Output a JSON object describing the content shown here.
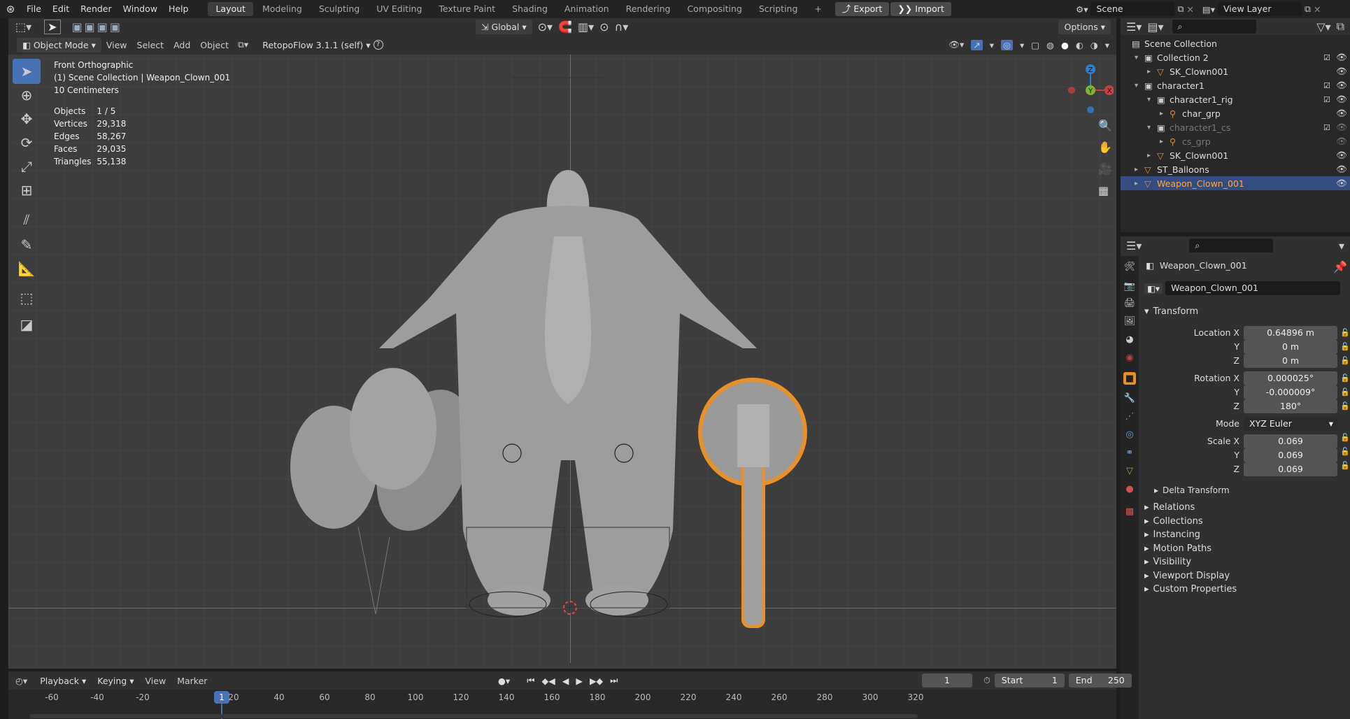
{
  "menu": {
    "items": [
      "File",
      "Edit",
      "Render",
      "Window",
      "Help"
    ]
  },
  "workspaces": [
    "Layout",
    "Modeling",
    "Sculpting",
    "UV Editing",
    "Texture Paint",
    "Shading",
    "Animation",
    "Rendering",
    "Compositing",
    "Scripting"
  ],
  "active_workspace": "Layout",
  "export_label": "Export",
  "import_label": "Import",
  "scene": "Scene",
  "view_layer": "View Layer",
  "header": {
    "mode": "Object Mode",
    "view": "View",
    "select": "Select",
    "add": "Add",
    "object": "Object",
    "orientation": "Global",
    "addon": "RetopoFlow 3.1.1 (self)",
    "options": "Options"
  },
  "viewport": {
    "view_name": "Front Orthographic",
    "collection_path": "(1) Scene Collection | Weapon_Clown_001",
    "scale": "10 Centimeters",
    "stats": [
      {
        "label": "Objects",
        "value": "1 / 5"
      },
      {
        "label": "Vertices",
        "value": "29,318"
      },
      {
        "label": "Edges",
        "value": "58,267"
      },
      {
        "label": "Faces",
        "value": "29,035"
      },
      {
        "label": "Triangles",
        "value": "55,138"
      }
    ]
  },
  "outliner": {
    "rows": [
      {
        "label": "Scene Collection",
        "depth": 0,
        "type": "scene"
      },
      {
        "label": "Collection 2",
        "depth": 1,
        "type": "collection"
      },
      {
        "label": "SK_Clown001",
        "depth": 2,
        "type": "mesh"
      },
      {
        "label": "character1",
        "depth": 1,
        "type": "collection"
      },
      {
        "label": "character1_rig",
        "depth": 2,
        "type": "collection"
      },
      {
        "label": "char_grp",
        "depth": 3,
        "type": "armature"
      },
      {
        "label": "character1_cs",
        "depth": 2,
        "type": "collection",
        "dim": true
      },
      {
        "label": "cs_grp",
        "depth": 3,
        "type": "armature",
        "dim": true
      },
      {
        "label": "SK_Clown001",
        "depth": 2,
        "type": "mesh"
      },
      {
        "label": "ST_Balloons",
        "depth": 1,
        "type": "mesh"
      },
      {
        "label": "Weapon_Clown_001",
        "depth": 1,
        "type": "mesh",
        "selected": true
      }
    ]
  },
  "properties": {
    "object_name": "Weapon_Clown_001",
    "datablock": "Weapon_Clown_001",
    "transform_label": "Transform",
    "location": {
      "label": "Location X",
      "x": "0.64896 m",
      "y": "0 m",
      "z": "0 m"
    },
    "rotation": {
      "label": "Rotation X",
      "x": "0.000025°",
      "y": "-0.000009°",
      "z": "180°"
    },
    "mode_label": "Mode",
    "mode_value": "XYZ Euler",
    "scale": {
      "label": "Scale X",
      "x": "0.069",
      "y": "0.069",
      "z": "0.069"
    },
    "axis_y": "Y",
    "axis_z": "Z",
    "delta": "Delta Transform",
    "panels": [
      "Relations",
      "Collections",
      "Instancing",
      "Motion Paths",
      "Visibility",
      "Viewport Display",
      "Custom Properties"
    ]
  },
  "timeline": {
    "playback": "Playback",
    "keying": "Keying",
    "view": "View",
    "marker": "Marker",
    "current_frame": "1",
    "start_label": "Start",
    "start": "1",
    "end_label": "End",
    "end": "250",
    "ticks": [
      "-60",
      "-40",
      "-20",
      "20",
      "40",
      "60",
      "80",
      "100",
      "120",
      "140",
      "160",
      "180",
      "200",
      "220",
      "240",
      "260",
      "280",
      "300",
      "320"
    ],
    "playhead": "1"
  },
  "colors": {
    "accent": "#4772b3",
    "selection": "#e8902a",
    "x_axis": "#c8403f",
    "z_axis": "#2f7fd0",
    "y_axis": "#7fb432"
  }
}
